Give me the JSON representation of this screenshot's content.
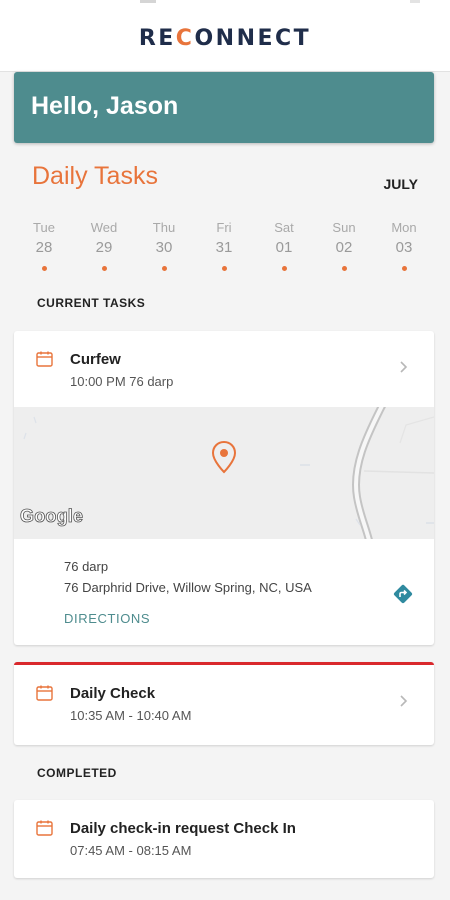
{
  "app": {
    "logo_before": "RE",
    "logo_accent": "C",
    "logo_after": "ONNECT"
  },
  "greeting": "Hello, Jason",
  "tasks_section": {
    "title": "Daily Tasks",
    "month": "JULY"
  },
  "days": [
    {
      "name": "Tue",
      "number": "28",
      "state": "past"
    },
    {
      "name": "Wed",
      "number": "29",
      "state": "past"
    },
    {
      "name": "Thu",
      "number": "30",
      "state": "past"
    },
    {
      "name": "Fri",
      "number": "31",
      "state": "selected"
    },
    {
      "name": "Sat",
      "number": "01",
      "state": "upcoming"
    },
    {
      "name": "Sun",
      "number": "02",
      "state": "upcoming"
    },
    {
      "name": "Mon",
      "number": "03",
      "state": "upcoming"
    }
  ],
  "current_tasks": {
    "heading": "CURRENT TASKS",
    "curfew": {
      "title": "Curfew",
      "time": "10:00 PM 76 darp",
      "map_attribution": "Google",
      "location_name": "76 darp",
      "location_address": "76 Darphrid Drive, Willow Spring, NC, USA",
      "directions_label": "DIRECTIONS"
    },
    "daily_check": {
      "title": "Daily Check",
      "time": "10:35 AM - 10:40 AM"
    }
  },
  "completed": {
    "heading": "COMPLETED",
    "item": {
      "title": "Daily check-in request Check In",
      "time": "07:45 AM - 08:15 AM"
    }
  },
  "colors": {
    "accent": "#e8743b",
    "teal": "#4e8c8e",
    "navy": "#1f2d4a",
    "alert": "#d9282c"
  },
  "icons": {
    "task": "calendar-icon",
    "open": "chevron-right-icon",
    "map_pin": "map-pin-icon",
    "directions": "directions-icon"
  }
}
